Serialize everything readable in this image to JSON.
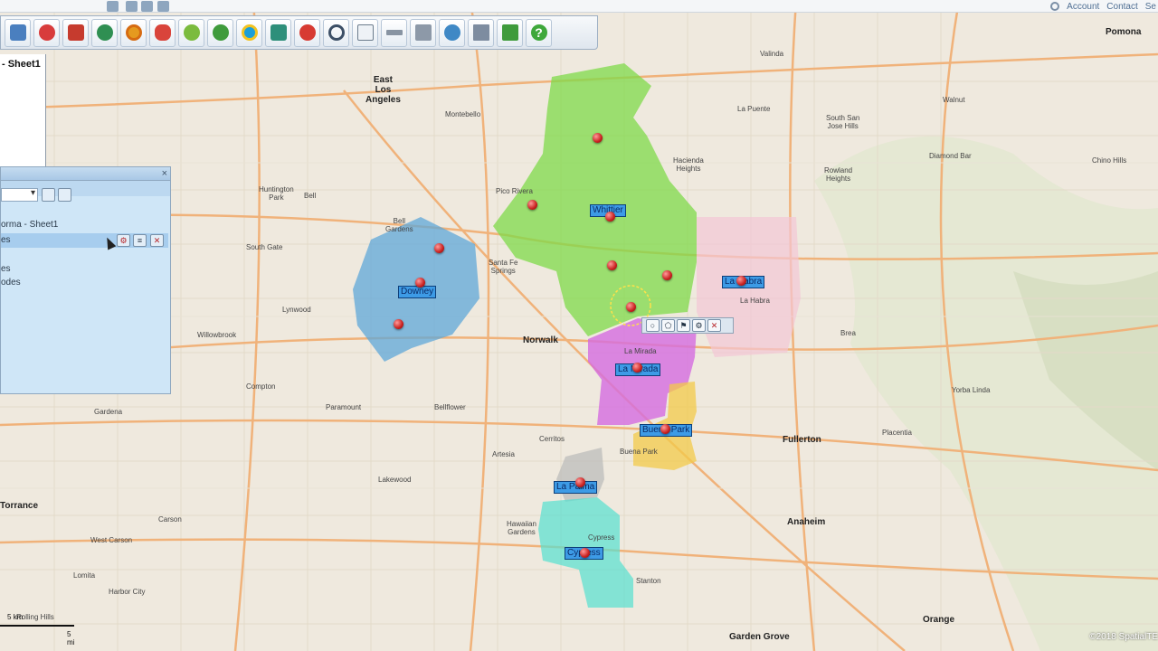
{
  "topbar": {
    "links": [
      "Account",
      "Contact",
      "Se"
    ]
  },
  "sheet_tab": {
    "label": "- Sheet1"
  },
  "layer_panel": {
    "layer_name": "orma - Sheet1",
    "row_selected": "es",
    "row_a": "es",
    "row_b": "odes",
    "close_glyph": "×"
  },
  "territories": [
    {
      "name": "Whittier",
      "color": "#7fd94a"
    },
    {
      "name": "Downey",
      "color": "#5fa7d8"
    },
    {
      "name": "La Habra",
      "color": "#f3c6d6"
    },
    {
      "name": "La Mirada",
      "color": "#d46be0"
    },
    {
      "name": "Buena Park",
      "color": "#f3c94a"
    },
    {
      "name": "La Palma",
      "color": "#b9b9b9"
    },
    {
      "name": "Cypress",
      "color": "#55e0d0"
    }
  ],
  "territory_labels": {
    "whittier": "Whittier",
    "downey": "Downey",
    "la_habra": "La Habra",
    "la_mirada": "La Mirada",
    "buena_park": "Buena Park",
    "la_palma": "La Palma",
    "cypress": "Cypress"
  },
  "cities": {
    "pomona": "Pomona",
    "east_la": "East\nLos\nAngeles",
    "fullerton": "Fullerton",
    "anaheim": "Anaheim",
    "orange": "Orange",
    "garden_grove": "Garden Grove",
    "torrance": "Torrance",
    "norwalk": "Norwalk"
  },
  "places": {
    "montebello": "Montebello",
    "valinda": "Valinda",
    "la_puente": "La Puente",
    "walnut": "Walnut",
    "south_san_jose": "South San\nJose Hills",
    "hacienda": "Hacienda\nHeights",
    "rowland": "Rowland\nHeights",
    "diamond_bar": "Diamond Bar",
    "chino_hills": "Chino Hills",
    "pico_rivera": "Pico Rivera",
    "huntington_park": "Huntington\nPark",
    "bell": "Bell",
    "bell_gardens": "Bell\nGardens",
    "south_gate": "South Gate",
    "santa_fe": "Santa Fe\nSprings",
    "lynwood": "Lynwood",
    "willowbrook": "Willowbrook",
    "compton": "Compton",
    "paramount": "Paramount",
    "bellflower": "Bellflower",
    "gardena": "Gardena",
    "cerritos": "Cerritos",
    "artesia": "Artesia",
    "lakewood": "Lakewood",
    "carson": "Carson",
    "hawaiian_gardens": "Hawaiian\nGardens",
    "stanton": "Stanton",
    "west_carson": "West Carson",
    "lomita": "Lomita",
    "harbor_city": "Harbor City",
    "rolling_hills": "Rolling Hills",
    "brea": "Brea",
    "placentia": "Placentia",
    "yorba_linda": "Yorba Linda",
    "la_mirada_small": "La Mirada",
    "la_habra_small": "La Habra",
    "buena_park_small": "Buena Park",
    "cypress_small": "Cypress"
  },
  "scale": {
    "km": "5 km",
    "mi": "5 mi"
  },
  "copyright": "©2018 SpatialTE"
}
